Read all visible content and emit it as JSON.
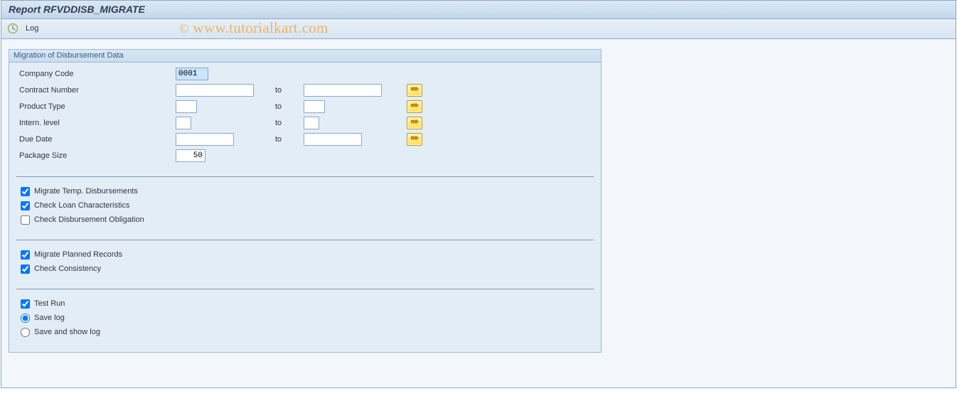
{
  "title": "Report RFVDDISB_MIGRATE",
  "toolbar": {
    "log_label": "Log"
  },
  "watermark": "www.tutorialkart.com",
  "group": {
    "title": "Migration of Disbursement Data",
    "fields": {
      "company_code": {
        "label": "Company Code",
        "value": "0001"
      },
      "contract_number": {
        "label": "Contract Number",
        "to": "to",
        "from_value": "",
        "to_value": ""
      },
      "product_type": {
        "label": "Product Type",
        "to": "to",
        "from_value": "",
        "to_value": ""
      },
      "intern_level": {
        "label": "Intern. level",
        "to": "to",
        "from_value": "",
        "to_value": ""
      },
      "due_date": {
        "label": "Due Date",
        "to": "to",
        "from_value": "",
        "to_value": ""
      },
      "package_size": {
        "label": "Package Size",
        "value": "50"
      }
    },
    "options1": {
      "migrate_temp": {
        "label": "Migrate Temp. Disbursements",
        "checked": true
      },
      "check_loan": {
        "label": "Check Loan Characteristics",
        "checked": true
      },
      "check_obligation": {
        "label": "Check Disbursement Obligation",
        "checked": false
      }
    },
    "options2": {
      "migrate_planned": {
        "label": "Migrate Planned Records",
        "checked": true
      },
      "check_consistency": {
        "label": "Check Consistency",
        "checked": true
      }
    },
    "options3": {
      "test_run": {
        "label": "Test Run",
        "checked": true
      },
      "save_log": {
        "label": "Save log",
        "selected": true
      },
      "save_show_log": {
        "label": "Save and show log",
        "selected": false
      }
    }
  }
}
